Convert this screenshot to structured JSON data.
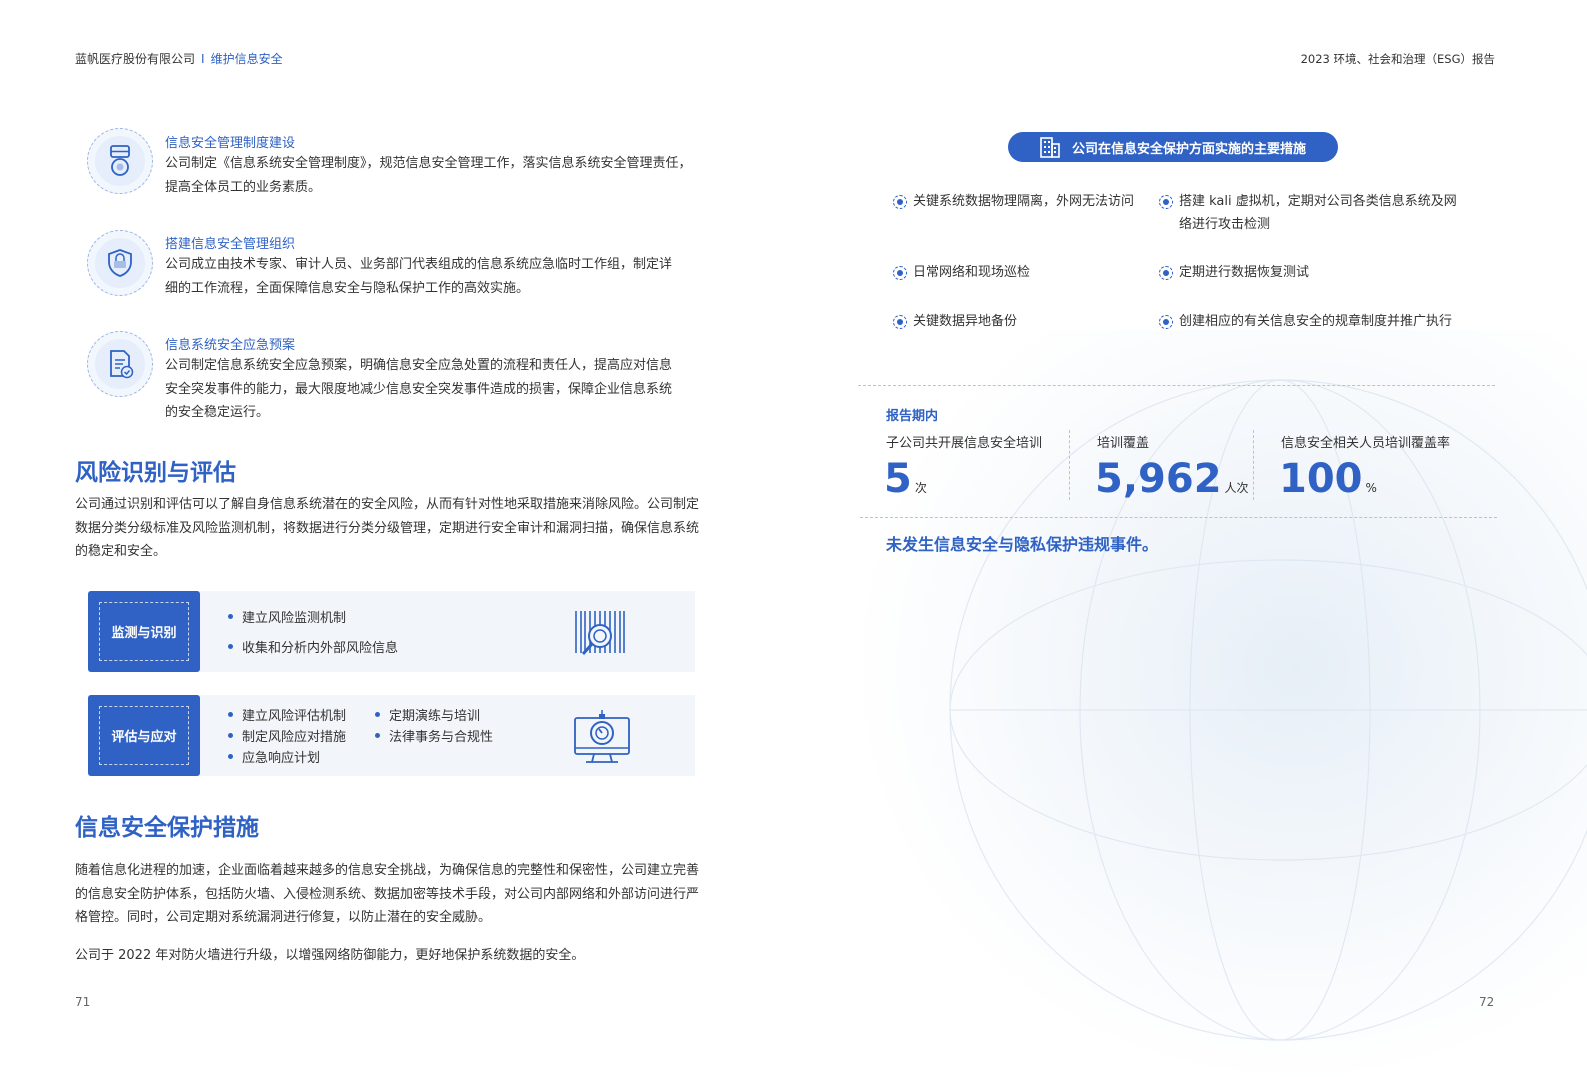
{
  "header": {
    "company": "蓝帆医疗股份有限公司",
    "separator": "I",
    "section": "维护信息安全",
    "report_title": "2023 环境、社会和治理（ESG）报告"
  },
  "pages": {
    "left": "71",
    "right": "72"
  },
  "left": {
    "items": [
      {
        "icon": "medal-icon",
        "title": "信息安全管理制度建设",
        "lines": [
          "公司制定《信息系统安全管理制度》，规范信息安全管理工作，落实信息系统安全管理责任，",
          "提高全体员工的业务素质。"
        ]
      },
      {
        "icon": "shield-icon",
        "title": "搭建信息安全管理组织",
        "lines": [
          "公司成立由技术专家、审计人员、业务部门代表组成的信息系统应急临时工作组，制定详",
          "细的工作流程，全面保障信息安全与隐私保护工作的高效实施。"
        ]
      },
      {
        "icon": "document-check-icon",
        "title": "信息系统安全应急预案",
        "lines": [
          "公司制定信息系统安全应急预案，明确信息安全应急处置的流程和责任人，提高应对信息",
          "安全突发事件的能力，最大限度地减少信息安全突发事件造成的损害，保障企业信息系统",
          "的安全稳定运行。"
        ]
      }
    ],
    "risk": {
      "heading": "风险识别与评估",
      "lines": [
        "公司通过识别和评估可以了解自身信息系统潜在的安全风险，从而有针对性地采取措施来消除风险。公司制定",
        "数据分类分级标准及风险监测机制，将数据进行分类分级管理，定期进行安全审计和漏洞扫描，确保信息系统",
        "的稳定和安全。"
      ],
      "box1": {
        "label": "监测与识别",
        "icon": "barcode-search-icon",
        "bullets": [
          "建立风险监测机制",
          "收集和分析内外部风险信息"
        ]
      },
      "box2": {
        "label": "评估与应对",
        "icon": "monitor-stopwatch-icon",
        "bullets_col1": [
          "建立风险评估机制",
          "制定风险应对措施",
          "应急响应计划"
        ],
        "bullets_col2": [
          "定期演练与培训",
          "法律事务与合规性"
        ]
      }
    },
    "protect": {
      "heading": "信息安全保护措施",
      "para1": [
        "随着信息化进程的加速，企业面临着越来越多的信息安全挑战，为确保信息的完整性和保密性，公司建立完善",
        "的信息安全防护体系，包括防火墙、入侵检测系统、数据加密等技术手段，对公司内部网络和外部访问进行严",
        "格管控。同时，公司定期对系统漏洞进行修复，以防止潜在的安全威胁。"
      ],
      "para2": "公司于 2022 年对防火墙进行升级，以增强网络防御能力，更好地保护系统数据的安全。"
    }
  },
  "right": {
    "banner": {
      "icon": "building-icon",
      "text": "公司在信息安全保护方面实施的主要措施"
    },
    "measures": [
      {
        "lines": [
          "关键系统数据物理隔离，外网无法访问"
        ]
      },
      {
        "lines": [
          "搭建 kali 虚拟机，定期对公司各类信息系统及网",
          "络进行攻击检测"
        ]
      },
      {
        "lines": [
          "日常网络和现场巡检"
        ]
      },
      {
        "lines": [
          "定期进行数据恢复测试"
        ]
      },
      {
        "lines": [
          "关键数据异地备份"
        ]
      },
      {
        "lines": [
          "创建相应的有关信息安全的规章制度并推广执行"
        ]
      }
    ],
    "period_label": "报告期内",
    "stats": [
      {
        "label": "子公司共开展信息安全培训",
        "value": "5",
        "unit": "次"
      },
      {
        "label": "培训覆盖",
        "value": "5,962",
        "unit": "人次"
      },
      {
        "label": "信息安全相关人员培训覆盖率",
        "value": "100",
        "unit": "%"
      }
    ],
    "no_incident": "未发生信息安全与隐私保护违规事件。",
    "colors": {
      "accent": "#2f62c4",
      "box_bg": "#f2f5fa"
    }
  }
}
